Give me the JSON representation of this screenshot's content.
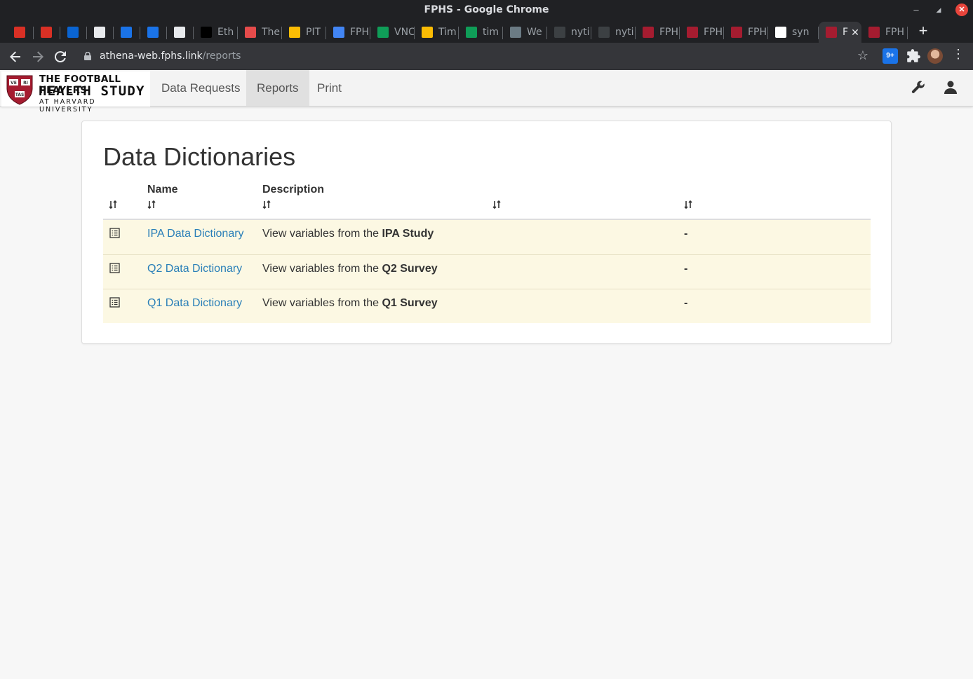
{
  "window": {
    "title": "FPHS - Google Chrome"
  },
  "tabs": [
    {
      "label": "",
      "icon": "gmail-icon",
      "color": "#d93025"
    },
    {
      "label": "",
      "icon": "gmail-icon",
      "color": "#d93025"
    },
    {
      "label": "",
      "icon": "outlook-icon",
      "color": "#0a64d2"
    },
    {
      "label": "",
      "icon": "reader-icon",
      "color": "#e8eaed"
    },
    {
      "label": "",
      "icon": "calendar-icon",
      "color": "#1a73e8"
    },
    {
      "label": "",
      "icon": "calendar-icon",
      "color": "#1a73e8"
    },
    {
      "label": "",
      "icon": "slack-icon",
      "color": "#e8eaed"
    },
    {
      "label": "Eth",
      "icon": "ii-icon",
      "color": "#000000"
    },
    {
      "label": "The",
      "icon": "ticket-icon",
      "color": "#e54b4b"
    },
    {
      "label": "PIT",
      "icon": "drive-icon",
      "color": "#fbbc04"
    },
    {
      "label": "FPH",
      "icon": "docs-icon",
      "color": "#4285f4"
    },
    {
      "label": "VNC",
      "icon": "sheets-icon",
      "color": "#0f9d58"
    },
    {
      "label": "Tim",
      "icon": "drive-icon",
      "color": "#fbbc04"
    },
    {
      "label": "tim",
      "icon": "sheets-icon",
      "color": "#0f9d58"
    },
    {
      "label": "We",
      "icon": "nyt-icon",
      "color": "#6b7b84"
    },
    {
      "label": "nyti",
      "icon": "github-icon",
      "color": "#3c4043"
    },
    {
      "label": "nyti",
      "icon": "github-icon",
      "color": "#3c4043"
    },
    {
      "label": "FPH",
      "icon": "harvard-icon",
      "color": "#a51c30"
    },
    {
      "label": "FPH",
      "icon": "harvard-icon",
      "color": "#a51c30"
    },
    {
      "label": "FPH",
      "icon": "harvard-icon",
      "color": "#a51c30"
    },
    {
      "label": "syn",
      "icon": "google-icon",
      "color": "#ffffff"
    },
    {
      "label": "F",
      "icon": "harvard-icon",
      "color": "#a51c30",
      "active": true
    },
    {
      "label": "FPH",
      "icon": "harvard-icon",
      "color": "#a51c30"
    }
  ],
  "address_bar": {
    "host": "athena-web.fphs.link",
    "path": "/reports"
  },
  "extensions": {
    "badge": "9+"
  },
  "brand": {
    "line1": "THE FOOTBALL PLAYERS",
    "line2": "HEALTH STUDY",
    "line3": "AT HARVARD UNIVERSITY",
    "shield_text": [
      "VE",
      "RI",
      "TAS"
    ]
  },
  "nav": {
    "links": [
      "Data Requests",
      "Reports",
      "Print"
    ],
    "active": "Reports"
  },
  "page": {
    "title": "Data Dictionaries",
    "columns": [
      "",
      "Name",
      "Description",
      "",
      ""
    ],
    "rows": [
      {
        "name": "IPA Data Dictionary",
        "desc_prefix": "View variables from the ",
        "desc_bold": "IPA Study",
        "extra": "-"
      },
      {
        "name": "Q2 Data Dictionary",
        "desc_prefix": "View variables from the ",
        "desc_bold": "Q2 Survey",
        "extra": "-"
      },
      {
        "name": "Q1 Data Dictionary",
        "desc_prefix": "View variables from the ",
        "desc_bold": "Q1 Survey",
        "extra": "-"
      }
    ]
  },
  "colors": {
    "row_highlight": "#fcf8e3",
    "link": "#2a7fb8",
    "harvard_crimson": "#a51c30"
  }
}
